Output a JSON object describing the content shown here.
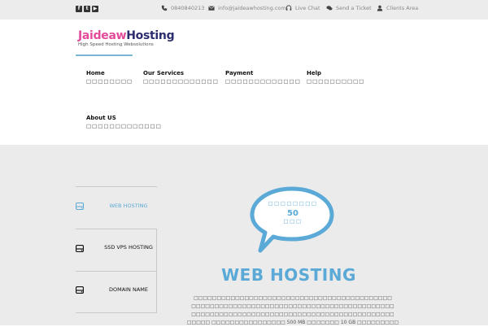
{
  "topbar": {
    "social": [
      {
        "icon": "facebook-icon",
        "glyph": "f"
      },
      {
        "icon": "twitter-icon",
        "glyph": "t"
      },
      {
        "icon": "youtube-icon",
        "glyph": "▶"
      }
    ],
    "phone": "0840840213",
    "email": "info@jaideawhosting.com",
    "live_chat": "Live Chat",
    "send_ticket": "Send a Ticket",
    "clients_area": "Clients Area"
  },
  "logo": {
    "brand_a": "Jai",
    "brand_b": "deaw",
    "brand_c": "Hosting",
    "tagline": "High Speed Hosting Websolutions"
  },
  "nav": [
    {
      "label": "Home",
      "sub": "□□□□□□□□"
    },
    {
      "label": "Our Services",
      "sub": "□□□□□□□□□□□□□"
    },
    {
      "label": "Payment",
      "sub": "□□□□□□□□□□□□□"
    },
    {
      "label": "Help",
      "sub": "□□□□□□□□□□"
    },
    {
      "label": "About US",
      "sub": "□□□□□□□□□□□□□"
    }
  ],
  "tabs": [
    {
      "label": "WEB HOSTING",
      "icon": "server-icon",
      "active": true
    },
    {
      "label": "SSD VPS HOSTING",
      "icon": "server-icon",
      "active": false
    },
    {
      "label": "DOMAIN NAME",
      "icon": "server-icon",
      "active": false
    }
  ],
  "plan": {
    "bubble_top": "□□□□□□□□",
    "price": "50",
    "bubble_bottom": "□□□",
    "title": "WEB HOSTING",
    "desc_line1": "□□□□□□□□□□□□□□□□□□□□□□□□□□□□□□□□□□□□□□□□□□□",
    "desc_line2": "□□□□□□□□□□□□□□□□□□□□□□□□□□□□□□□□□□□□□□□□□□□□",
    "desc_line3": "□□□□□□□□□□□□□□□□□□□□□□□□□□□□□□□□□□□□□□□□□□□□",
    "desc_line4": "□□□□□ □□□□□□□□□□□□□□□□ 500 MB □□□□□□□ 10 GB □□□□□□□□□"
  },
  "colors": {
    "accent": "#5aa9d6",
    "topbar_bg": "#ececec",
    "content_bg": "#ebebeb",
    "brand_pink": "#e44a9a",
    "brand_navy": "#2b2d6e"
  }
}
